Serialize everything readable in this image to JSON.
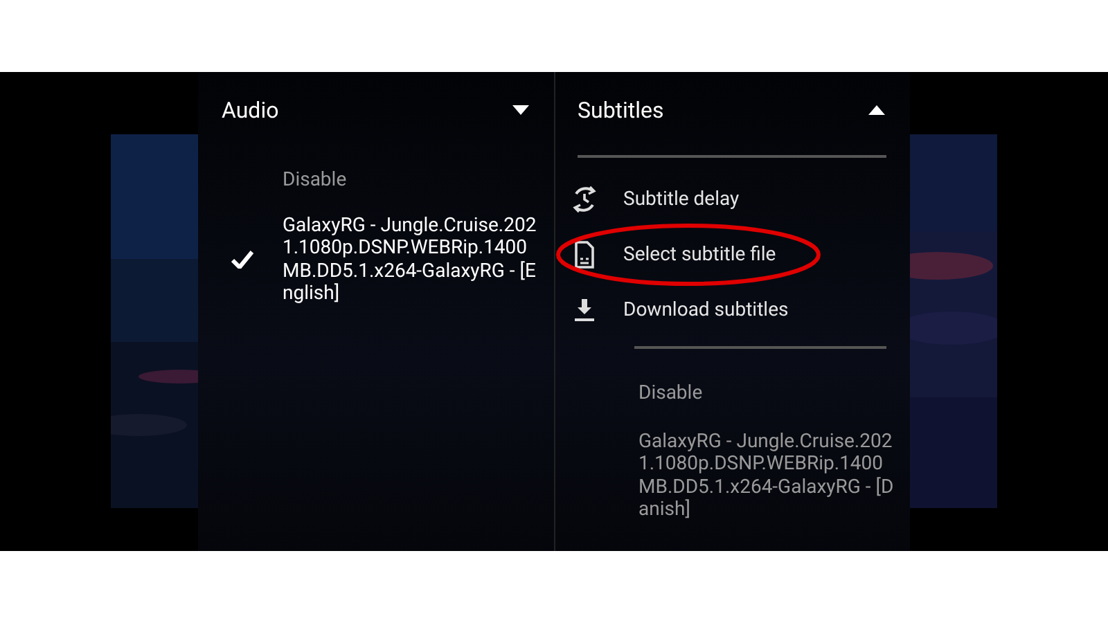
{
  "audio": {
    "title": "Audio",
    "expanded": false,
    "tracks": [
      {
        "label": "Disable",
        "selected": false
      },
      {
        "label": "GalaxyRG - Jungle.Cruise.2021.1080p.DSNP.WEBRip.1400MB.DD5.1.x264-GalaxyRG - [English]",
        "selected": true
      }
    ]
  },
  "subtitles": {
    "title": "Subtitles",
    "expanded": true,
    "actions": [
      {
        "kind": "delay",
        "label": "Subtitle delay",
        "highlighted": false
      },
      {
        "kind": "file",
        "label": "Select subtitle file",
        "highlighted": true
      },
      {
        "kind": "download",
        "label": "Download subtitles",
        "highlighted": false
      }
    ],
    "tracks": [
      {
        "label": "Disable",
        "selected": false
      },
      {
        "label": "GalaxyRG - Jungle.Cruise.2021.1080p.DSNP.WEBRip.1400MB.DD5.1.x264-GalaxyRG - [Danish]",
        "selected": false
      }
    ]
  }
}
